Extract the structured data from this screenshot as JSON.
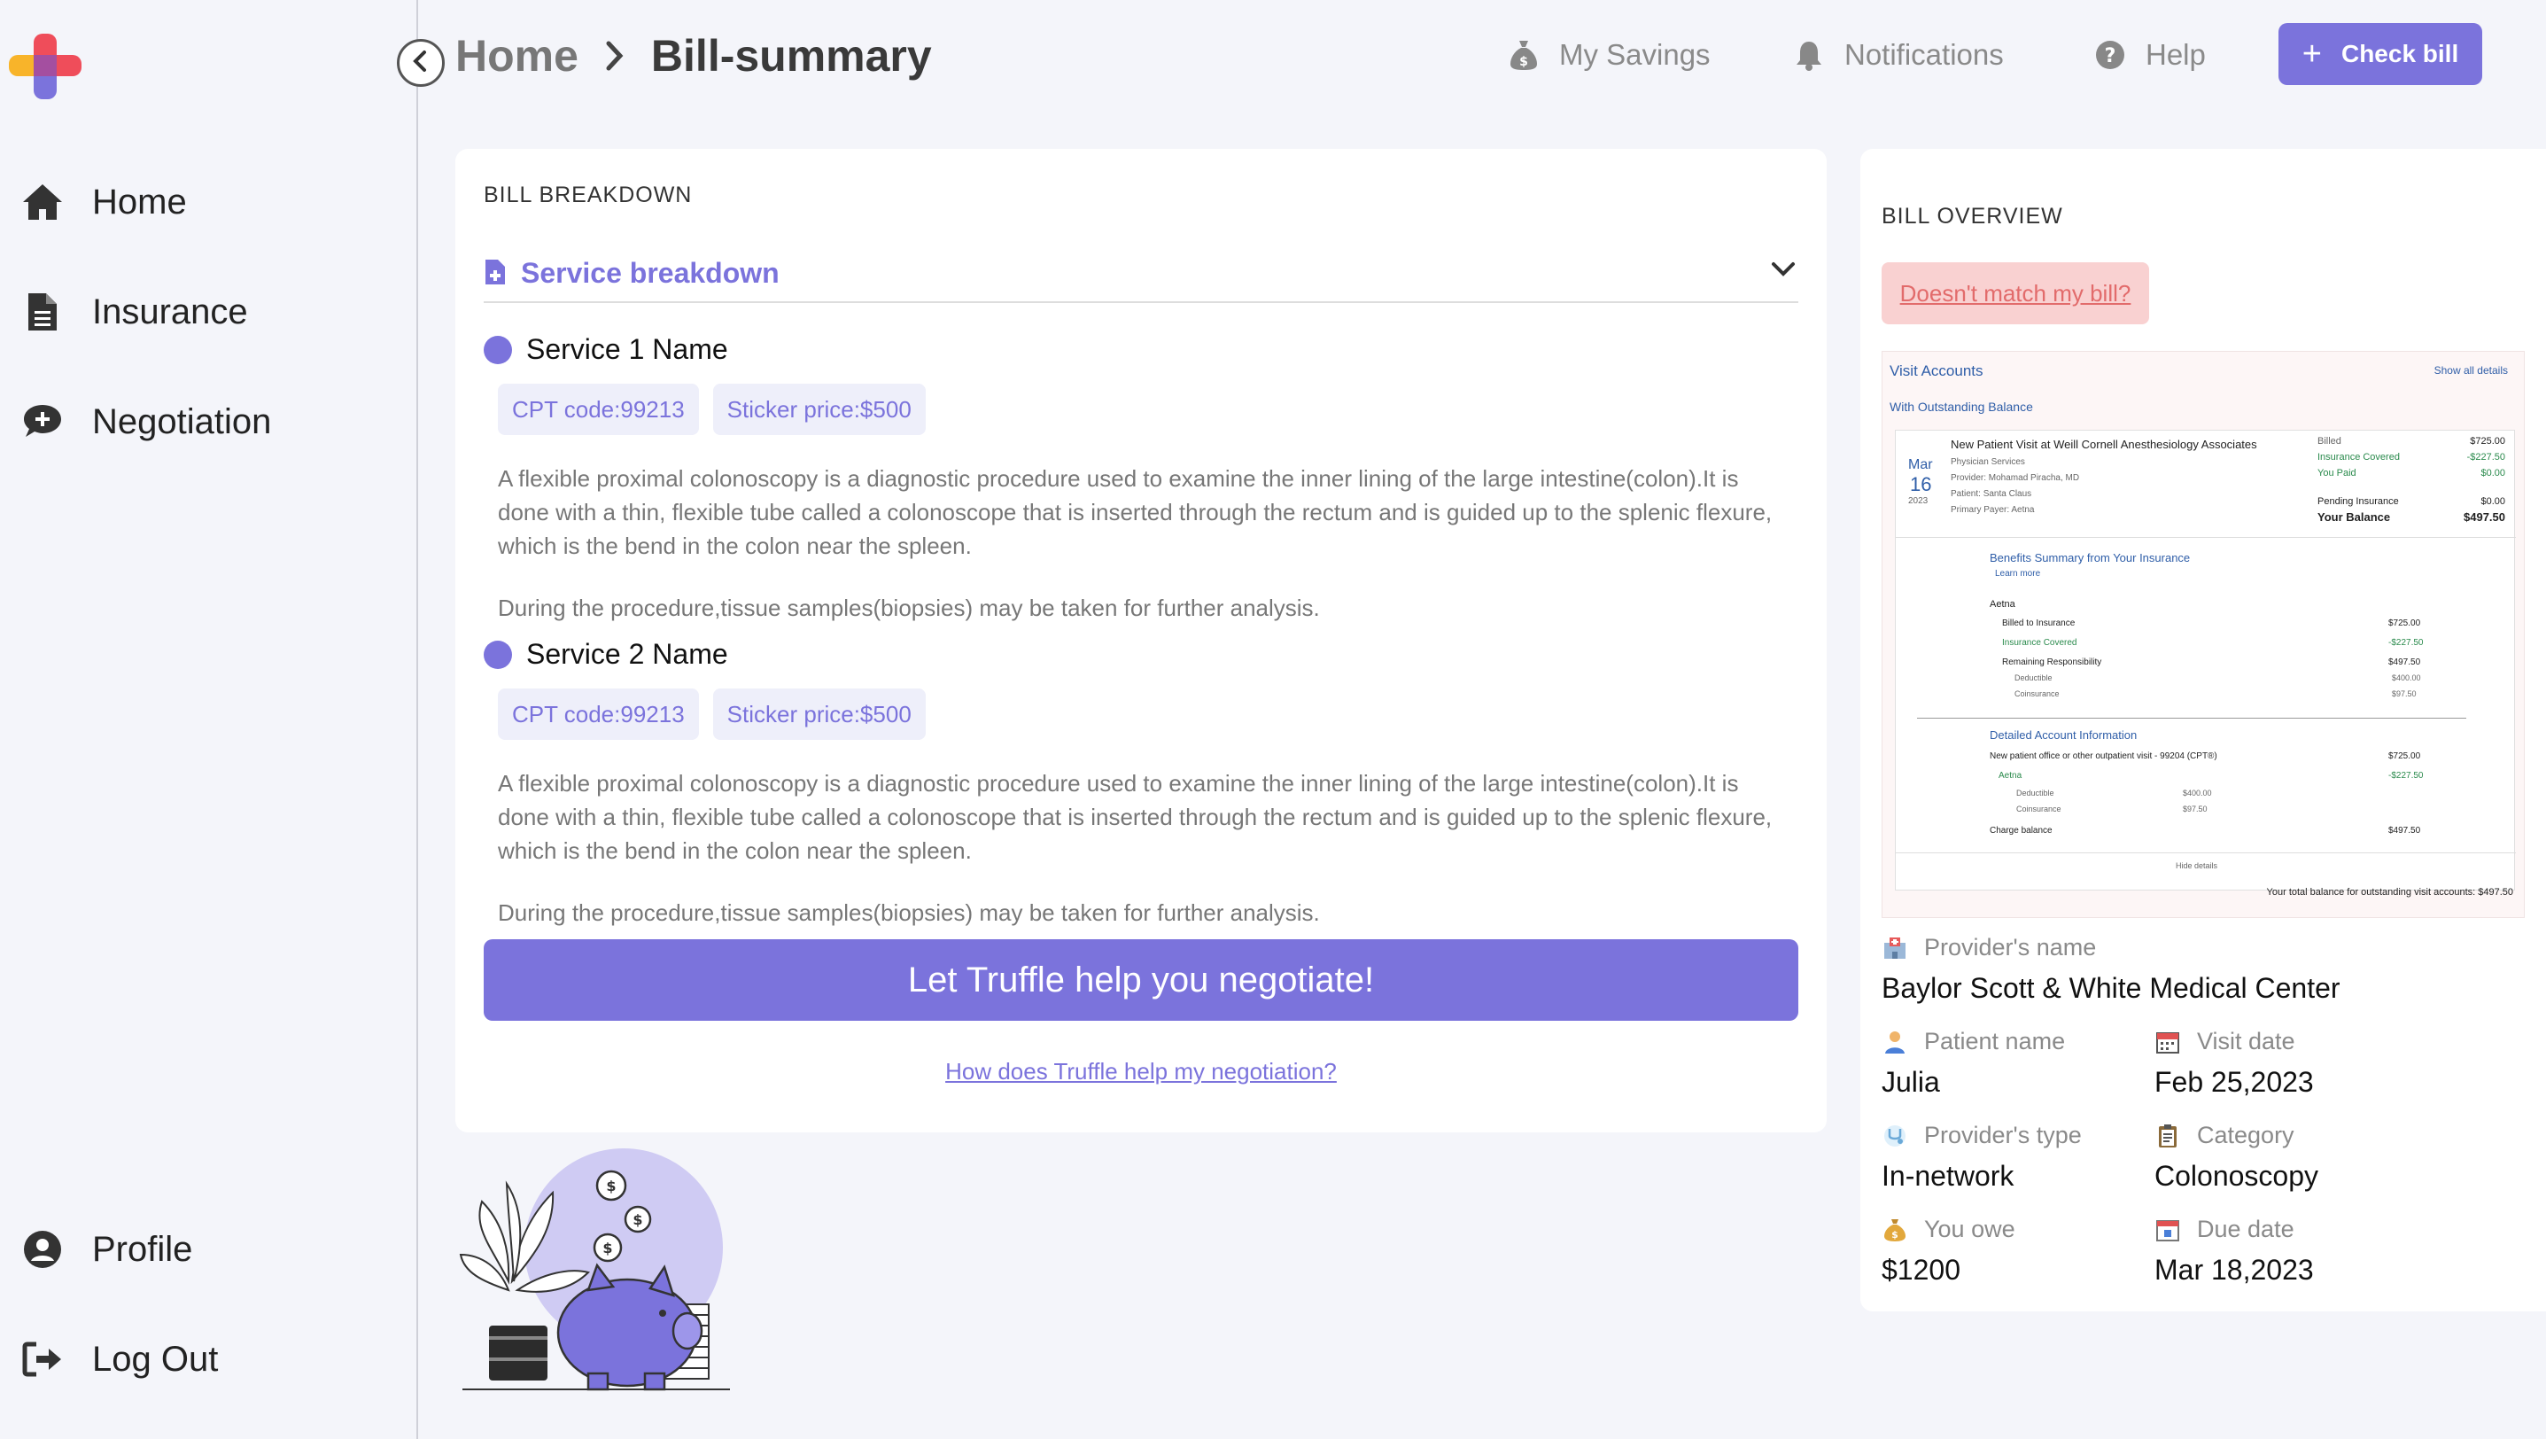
{
  "sidebar": {
    "items": [
      {
        "label": "Home",
        "icon": "home-icon"
      },
      {
        "label": "Insurance",
        "icon": "document-icon"
      },
      {
        "label": "Negotiation",
        "icon": "chat-plus-icon"
      }
    ],
    "bottom_items": [
      {
        "label": "Profile",
        "icon": "user-circle-icon"
      },
      {
        "label": "Log Out",
        "icon": "logout-icon"
      }
    ]
  },
  "header": {
    "breadcrumb": {
      "home": "Home",
      "current": "Bill-summary"
    },
    "links": [
      {
        "label": "My Savings",
        "icon": "money-bag-icon"
      },
      {
        "label": "Notifications",
        "icon": "bell-icon"
      },
      {
        "label": "Help",
        "icon": "help-icon"
      }
    ],
    "check_bill_label": "Check bill"
  },
  "breakdown": {
    "title": "BILL BREAKDOWN",
    "service_header": "Service breakdown",
    "services": [
      {
        "name": "Service 1 Name",
        "cpt": "CPT code:99213",
        "price": "Sticker price:$500",
        "description": "A flexible proximal colonoscopy is a diagnostic procedure used to examine the inner lining of the large intestine(colon).It is done with a thin, flexible tube called a colonoscope that is inserted through the rectum and is guided up to the splenic flexure, which is the bend in the colon near the spleen.",
        "note": "During the procedure,tissue samples(biopsies) may be taken for further analysis."
      },
      {
        "name": "Service 2 Name",
        "cpt": "CPT code:99213",
        "price": "Sticker price:$500",
        "description": "A flexible proximal colonoscopy is a diagnostic procedure used to examine the inner lining of the large intestine(colon).It is done with a thin, flexible tube called a colonoscope that is inserted through the rectum and is guided up to the splenic flexure, which is the bend in the colon near the spleen.",
        "note": "During the procedure,tissue samples(biopsies) may be taken for further analysis."
      }
    ],
    "negotiate_label": "Let Truffle help you negotiate!",
    "how_link": "How does Truffle help my negotiation?"
  },
  "overview": {
    "title": "BILL OVERVIEW",
    "mismatch_label": "Doesn't match my bill?",
    "bill_image": {
      "visit_accounts": "Visit Accounts",
      "show_all": "Show all details",
      "outstanding": "With Outstanding Balance",
      "visit_title": "New Patient Visit at Weill Cornell Anesthesiology Associates",
      "visit_sub": "Physician Services",
      "provider": "Provider: Mohamad Piracha, MD",
      "patient": "Patient: Santa Claus",
      "payer": "Primary Payer: Aetna",
      "month": "Mar",
      "day": "16",
      "year": "2023",
      "billed_label": "Billed",
      "billed": "$725.00",
      "ins_covered_label": "Insurance Covered",
      "ins_covered": "-$227.50",
      "you_paid_label": "You Paid",
      "you_paid": "$0.00",
      "pending_label": "Pending Insurance",
      "pending": "$0.00",
      "balance_label": "Your Balance",
      "balance": "$497.50",
      "benefits_title": "Benefits Summary from Your Insurance",
      "learn_more": "Learn more",
      "aetna": "Aetna",
      "billed_ins_label": "Billed to Insurance",
      "billed_ins": "$725.00",
      "ins_cov2_label": "Insurance Covered",
      "ins_cov2": "-$227.50",
      "remaining_label": "Remaining Responsibility",
      "remaining": "$497.50",
      "deductible_label": "Deductible",
      "deductible": "$400.00",
      "coins_label": "Coinsurance",
      "coins": "$97.50",
      "detailed_title": "Detailed Account Information",
      "line_item": "New patient office or other outpatient visit - 99204 (CPT®)",
      "line_amt": "$725.00",
      "aetna2": "Aetna",
      "aetna2_amt": "-$227.50",
      "ded2_label": "Deductible",
      "ded2": "$400.00",
      "coins2_label": "Coinsurance",
      "coins2": "$97.50",
      "charge_label": "Charge balance",
      "charge": "$497.50",
      "hide": "Hide details",
      "total": "Your total balance for outstanding visit accounts: $497.50"
    },
    "provider_name_label": "Provider's name",
    "provider_name": "Baylor Scott & White Medical Center",
    "patient_name_label": "Patient name",
    "patient_name": "Julia",
    "visit_date_label": "Visit date",
    "visit_date": "Feb 25,2023",
    "provider_type_label": "Provider's type",
    "provider_type": "In-network",
    "category_label": "Category",
    "category": "Colonoscopy",
    "you_owe_label": "You owe",
    "you_owe": "$1200",
    "due_date_label": "Due date",
    "due_date": "Mar 18,2023"
  },
  "colors": {
    "accent": "#7b73dc",
    "background": "#f4f5fa",
    "tag_bg": "#eeeffa",
    "warning_bg": "#f9d1d1",
    "warning_text": "#e26b6b"
  }
}
